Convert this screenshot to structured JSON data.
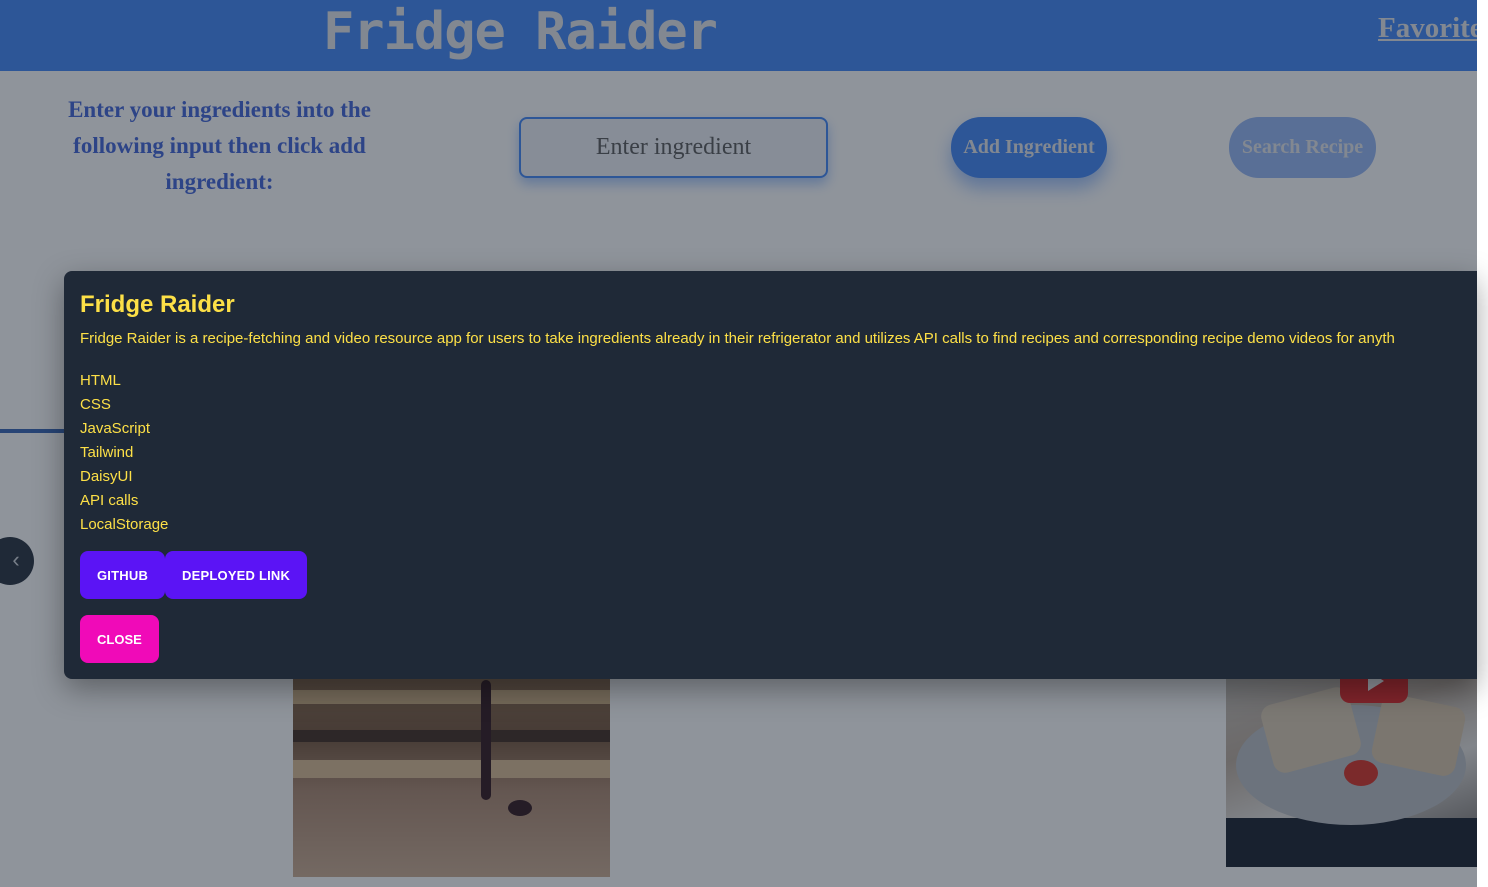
{
  "header": {
    "title": "Fridge Raider",
    "favorites_label": "Favorite"
  },
  "search": {
    "instructions": "Enter your ingredients into the following input then click add ingredient:",
    "placeholder": "Enter ingredient",
    "add_label": "Add Ingredient",
    "search_label": "Search Recipe"
  },
  "carousel": {
    "prev_label": "‹"
  },
  "modal": {
    "title": "Fridge Raider",
    "description": "Fridge Raider is a recipe-fetching and video resource app for users to take ingredients already in their refrigerator and utilizes API calls to find recipes and corresponding recipe demo videos for anyth",
    "technologies": [
      "HTML",
      "CSS",
      "JavaScript",
      "Tailwind",
      "DaisyUI",
      "API calls",
      "LocalStorage"
    ],
    "github_label": "Github",
    "deployed_label": "Deployed Link",
    "close_label": "Close"
  },
  "colors": {
    "header_bg": "#3b82f6",
    "modal_bg": "#1f2937",
    "modal_text": "#fde047",
    "primary_button": "#5b14f5",
    "close_button": "#f00ab8"
  },
  "icons": {
    "prev": "chevron-left-icon",
    "video_play": "youtube-play-icon"
  }
}
